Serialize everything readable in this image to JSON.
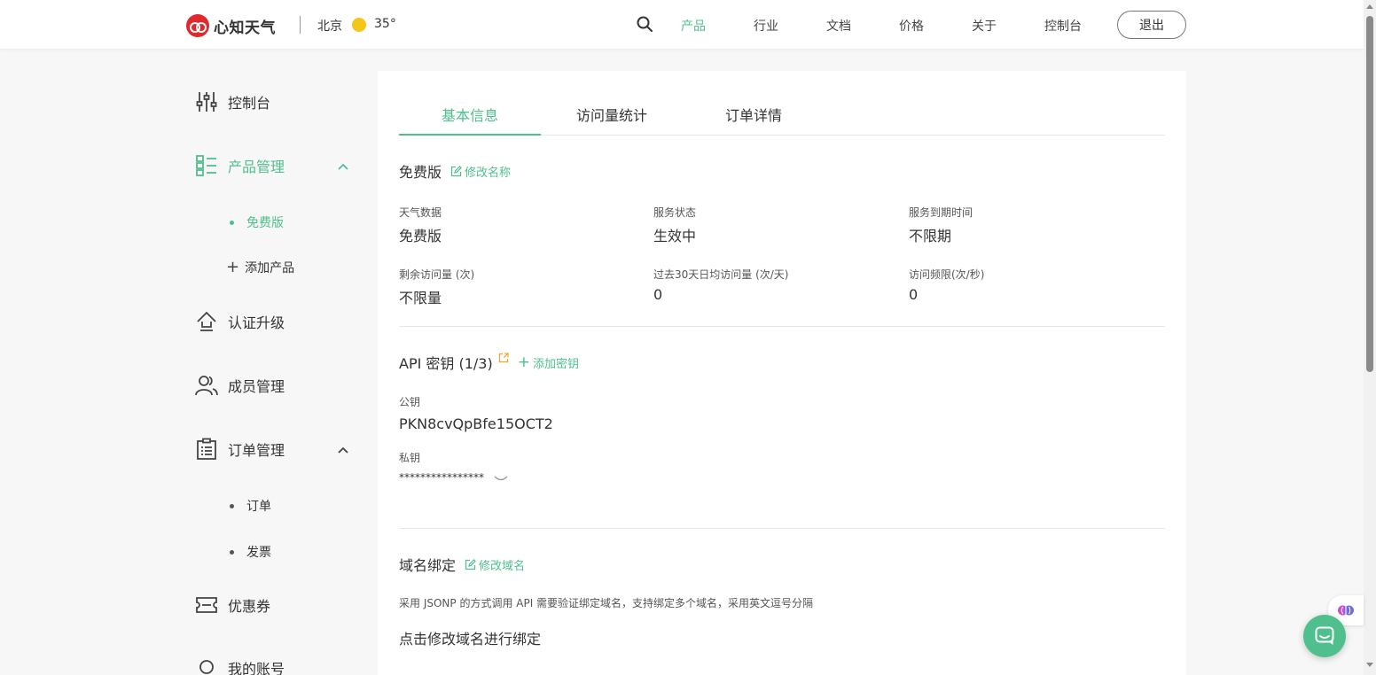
{
  "header": {
    "logo_text": "心知天气",
    "city": "北京",
    "temperature": "35°",
    "nav": [
      {
        "label": "产品",
        "active": true
      },
      {
        "label": "行业",
        "active": false
      },
      {
        "label": "文档",
        "active": false
      },
      {
        "label": "价格",
        "active": false
      },
      {
        "label": "关于",
        "active": false
      },
      {
        "label": "控制台",
        "active": false
      }
    ],
    "logout_label": "退出"
  },
  "sidebar": {
    "console": "控制台",
    "product_mgmt": "产品管理",
    "product_sub": [
      "免费版",
      "添加产品"
    ],
    "cert_upgrade": "认证升级",
    "member_mgmt": "成员管理",
    "order_mgmt": "订单管理",
    "order_sub": [
      "订单",
      "发票"
    ],
    "coupons": "优惠券",
    "my_account": "我的账号"
  },
  "main": {
    "tabs": [
      {
        "label": "基本信息",
        "active": true
      },
      {
        "label": "访问量统计",
        "active": false
      },
      {
        "label": "订单详情",
        "active": false
      }
    ],
    "plan": {
      "name": "免费版",
      "edit_name": "修改名称",
      "fields": [
        {
          "label": "天气数据",
          "value": "免费版"
        },
        {
          "label": "服务状态",
          "value": "生效中"
        },
        {
          "label": "服务到期时间",
          "value": "不限期"
        },
        {
          "label": "剩余访问量 (次)",
          "value": "不限量"
        },
        {
          "label": "过去30天日均访问量 (次/天)",
          "value": "0"
        },
        {
          "label": "访问频限(次/秒)",
          "value": "0"
        }
      ]
    },
    "api": {
      "title": "API 密钥 (1/3)",
      "add_key": "添加密钥",
      "public_label": "公钥",
      "public_value": "PKN8cvQpBfe15OCT2",
      "private_label": "私钥",
      "private_value": "****************"
    },
    "domain": {
      "title": "域名绑定",
      "edit": "修改域名",
      "note": "采用 JSONP 的方式调用 API 需要验证绑定域名，支持绑定多个域名，采用英文逗号分隔",
      "placeholder": "点击修改域名进行绑定"
    }
  },
  "colors": {
    "accent": "#4fc08d",
    "brand": "#e0292c",
    "sun": "#f5c518",
    "external_link": "#f5a623"
  }
}
